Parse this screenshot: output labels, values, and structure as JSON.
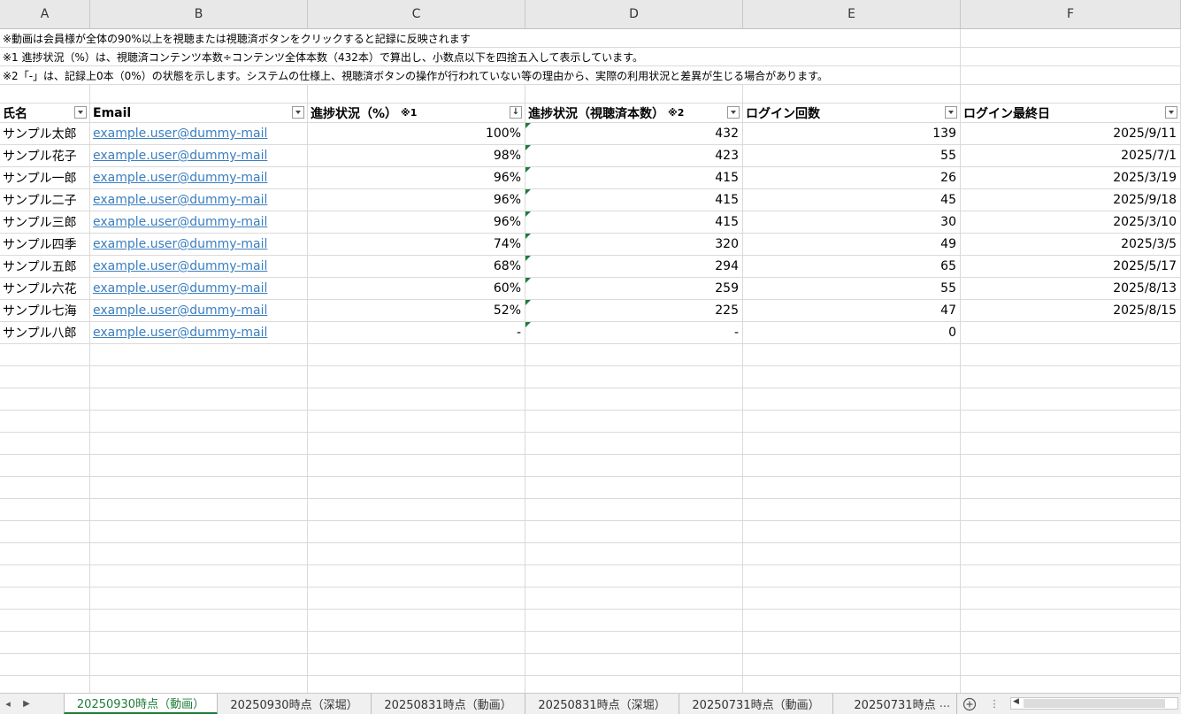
{
  "columns": [
    "A",
    "B",
    "C",
    "D",
    "E",
    "F"
  ],
  "notes": [
    "※動画は会員様が全体の90%以上を視聴または視聴済ボタンをクリックすると記録に反映されます",
    "※1 進捗状況（%）は、視聴済コンテンツ本数÷コンテンツ全体本数（432本）で算出し、小数点以下を四捨五入して表示しています。",
    "※2「-」は、記録上0本（0%）の状態を示します。システムの仕様上、視聴済ボタンの操作が行われていない等の理由から、実際の利用状況と差異が生じる場合があります。"
  ],
  "headers": {
    "name": "氏名",
    "email": "Email",
    "progress_pct": "進捗状況（%）",
    "progress_pct_note": "※1",
    "progress_count": "進捗状況（視聴済本数）",
    "progress_count_note": "※2",
    "login_count": "ログイン回数",
    "last_login": "ログイン最終日"
  },
  "rows": [
    {
      "name": "サンプル太郎",
      "email": "example.user@dummy-mail",
      "pct": "100%",
      "count": "432",
      "logins": "139",
      "last": "2025/9/11"
    },
    {
      "name": "サンプル花子",
      "email": "example.user@dummy-mail",
      "pct": "98%",
      "count": "423",
      "logins": "55",
      "last": "2025/7/1"
    },
    {
      "name": "サンプル一郎",
      "email": "example.user@dummy-mail",
      "pct": "96%",
      "count": "415",
      "logins": "26",
      "last": "2025/3/19"
    },
    {
      "name": "サンプル二子",
      "email": "example.user@dummy-mail",
      "pct": "96%",
      "count": "415",
      "logins": "45",
      "last": "2025/9/18"
    },
    {
      "name": "サンプル三郎",
      "email": "example.user@dummy-mail",
      "pct": "96%",
      "count": "415",
      "logins": "30",
      "last": "2025/3/10"
    },
    {
      "name": "サンプル四季",
      "email": "example.user@dummy-mail",
      "pct": "74%",
      "count": "320",
      "logins": "49",
      "last": "2025/3/5"
    },
    {
      "name": "サンプル五郎",
      "email": "example.user@dummy-mail",
      "pct": "68%",
      "count": "294",
      "logins": "65",
      "last": "2025/5/17"
    },
    {
      "name": "サンプル六花",
      "email": "example.user@dummy-mail",
      "pct": "60%",
      "count": "259",
      "logins": "55",
      "last": "2025/8/13"
    },
    {
      "name": "サンプル七海",
      "email": "example.user@dummy-mail",
      "pct": "52%",
      "count": "225",
      "logins": "47",
      "last": "2025/8/15"
    },
    {
      "name": "サンプル八郎",
      "email": "example.user@dummy-mail",
      "pct": "-",
      "count": "-",
      "logins": "0",
      "last": ""
    }
  ],
  "tabs": [
    {
      "label": "20250930時点（動画）",
      "active": true
    },
    {
      "label": "20250930時点（深堀）",
      "active": false
    },
    {
      "label": "20250831時点（動画）",
      "active": false
    },
    {
      "label": "20250831時点（深堀）",
      "active": false
    },
    {
      "label": "20250731時点（動画）",
      "active": false
    },
    {
      "label": "20250731時点",
      "active": false
    }
  ],
  "tab_more": "...",
  "colors": {
    "accent": "#1e7c3a",
    "link": "#3a7ebf"
  },
  "icons": {
    "add_sheet": "plus-circle-icon",
    "nav_next": "triangle-right-icon"
  }
}
